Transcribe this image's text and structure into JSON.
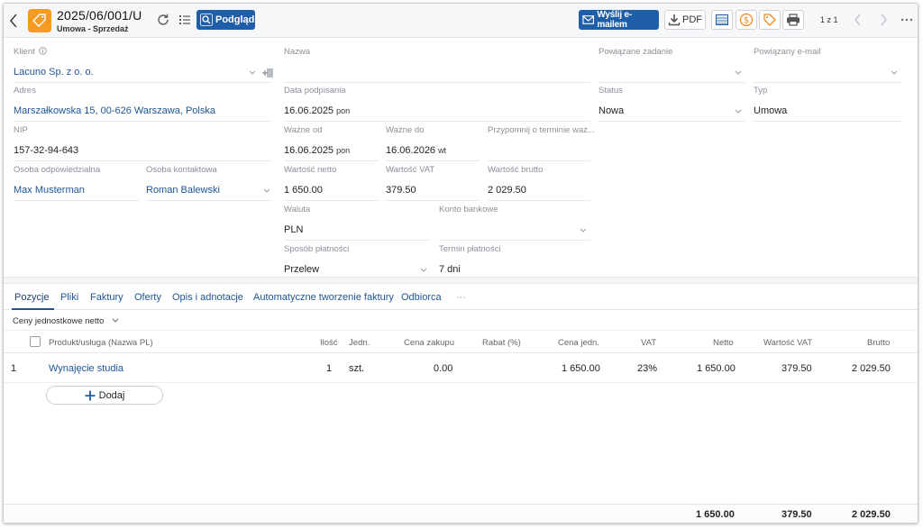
{
  "header": {
    "title": "2025/06/001/U",
    "subtitle": "Umowa - Sprzedaż",
    "preview_label": "Podgląd",
    "email_label": "Wyślij e-mailem",
    "pdf_label": "PDF",
    "pager": "1 z 1",
    "colors": {
      "accent": "#1f5faa",
      "doc_icon": "#f59a23"
    },
    "icons": [
      "back-icon",
      "tag-icon",
      "refresh-icon",
      "list-icon",
      "magnifier-icon",
      "envelope-icon",
      "download-icon",
      "table-icon",
      "dollar-icon",
      "tag-outline-icon",
      "printer-icon",
      "chevron-left-icon",
      "chevron-right-icon",
      "more-icon"
    ]
  },
  "form": {
    "klient": {
      "label": "Klient",
      "value": "Lacuno Sp. z o. o."
    },
    "nazwa": {
      "label": "Nazwa",
      "value": ""
    },
    "powiazane_zadanie": {
      "label": "Powiązane zadanie",
      "value": ""
    },
    "powiazany_email": {
      "label": "Powiązany e-mail",
      "value": ""
    },
    "adres": {
      "label": "Adres",
      "value": "Marszałkowska 15, 00-626 Warszawa, Polska"
    },
    "data_podpisania": {
      "label": "Data podpisania",
      "value": "16.06.2025",
      "day": "pon"
    },
    "status": {
      "label": "Status",
      "value": "Nowa"
    },
    "typ": {
      "label": "Typ",
      "value": "Umowa"
    },
    "nip": {
      "label": "NIP",
      "value": "157-32-94-643"
    },
    "wazne_od": {
      "label": "Ważne od",
      "value": "16.06.2025",
      "day": "pon"
    },
    "wazne_do": {
      "label": "Ważne do",
      "value": "16.06.2026",
      "day": "wt"
    },
    "przypomnij": {
      "label": "Przypomnij o terminie waż...",
      "value": ""
    },
    "osoba_odpowiedzialna": {
      "label": "Osoba odpowiedzialna",
      "value": "Max Musterman"
    },
    "osoba_kontaktowa": {
      "label": "Osoba kontaktowa",
      "value": "Roman Balewski"
    },
    "wartosc_netto": {
      "label": "Wartość netto",
      "value": "1 650.00"
    },
    "wartosc_vat": {
      "label": "Wartość VAT",
      "value": "379.50"
    },
    "wartosc_brutto": {
      "label": "Wartość brutto",
      "value": "2 029.50"
    },
    "waluta": {
      "label": "Waluta",
      "value": "PLN"
    },
    "konto_bankowe": {
      "label": "Konto bankowe",
      "value": ""
    },
    "sposob_platnosci": {
      "label": "Sposób płatności",
      "value": "Przelew"
    },
    "termin_platnosci": {
      "label": "Termin płatności",
      "value": "7 dni"
    }
  },
  "tabs": [
    "Pozycje",
    "Pliki",
    "Faktury",
    "Oferty",
    "Opis i adnotacje",
    "Automatyczne tworzenie faktury",
    "Odbiorca",
    "···"
  ],
  "price_mode": "Ceny jednostkowe netto",
  "table": {
    "headers": {
      "product": "Produkt/usługa (Nazwa PL)",
      "qty": "Ilość",
      "unit": "Jedn.",
      "cost": "Cena zakupu",
      "discount": "Rabat (%)",
      "unit_price": "Cena jedn.",
      "vat": "VAT",
      "net": "Netto",
      "vat_value": "Wartość VAT",
      "gross": "Brutto"
    },
    "rows": [
      {
        "no": "1",
        "product": "Wynajęcie studia",
        "qty": "1",
        "unit": "szt.",
        "cost": "0.00",
        "discount": "",
        "unit_price": "1 650.00",
        "vat": "23%",
        "net": "1 650.00",
        "vat_value": "379.50",
        "gross": "2 029.50"
      }
    ],
    "add_label": "Dodaj",
    "totals": {
      "net": "1 650.00",
      "vat_value": "379.50",
      "gross": "2 029.50"
    }
  }
}
